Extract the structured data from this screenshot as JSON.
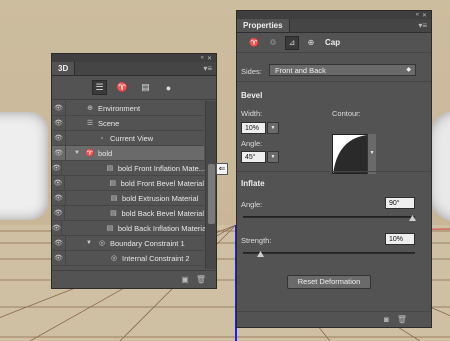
{
  "panel_3d": {
    "tab": "3D",
    "rows": [
      {
        "label": "Environment",
        "icon": "environment-icon",
        "glyph": "⊕",
        "indent": 0,
        "expander": ""
      },
      {
        "label": "Scene",
        "icon": "scene-icon",
        "glyph": "☰",
        "indent": 0,
        "expander": ""
      },
      {
        "label": "Current View",
        "icon": "camera-icon",
        "glyph": "▫",
        "indent": 1,
        "expander": ""
      },
      {
        "label": "bold",
        "icon": "mesh-icon",
        "glyph": "♈",
        "indent": 0,
        "expander": "▼",
        "selected": true
      },
      {
        "label": "bold Front Inflation Mate...",
        "icon": "material-icon",
        "glyph": "▤",
        "indent": 2,
        "expander": ""
      },
      {
        "label": "bold Front Bevel Material",
        "icon": "material-icon",
        "glyph": "▤",
        "indent": 2,
        "expander": ""
      },
      {
        "label": "bold Extrusion Material",
        "icon": "material-icon",
        "glyph": "▤",
        "indent": 2,
        "expander": ""
      },
      {
        "label": "bold Back Bevel Material",
        "icon": "material-icon",
        "glyph": "▤",
        "indent": 2,
        "expander": ""
      },
      {
        "label": "bold Back Inflation Material",
        "icon": "material-icon",
        "glyph": "▤",
        "indent": 2,
        "expander": ""
      },
      {
        "label": "Boundary Constraint 1",
        "icon": "constraint-icon",
        "glyph": "◎",
        "indent": 1,
        "expander": "▼"
      },
      {
        "label": "Internal Constraint 2",
        "icon": "constraint-icon",
        "glyph": "◎",
        "indent": 2,
        "expander": ""
      }
    ]
  },
  "properties": {
    "tab": "Properties",
    "mode_label": "Cap",
    "sides_label": "Sides:",
    "sides_value": "Front and Back",
    "bevel_title": "Bevel",
    "width_label": "Width:",
    "width_value": "10%",
    "contour_label": "Contour:",
    "angle_label": "Angle:",
    "angle_value": "45°",
    "inflate_title": "Inflate",
    "inflate_angle_label": "Angle:",
    "inflate_angle_value": "90°",
    "strength_label": "Strength:",
    "strength_value": "10%",
    "reset_button": "Reset Deformation"
  },
  "colors": {
    "accent_line": "#1a1aff",
    "panel_bg": "#535353"
  }
}
